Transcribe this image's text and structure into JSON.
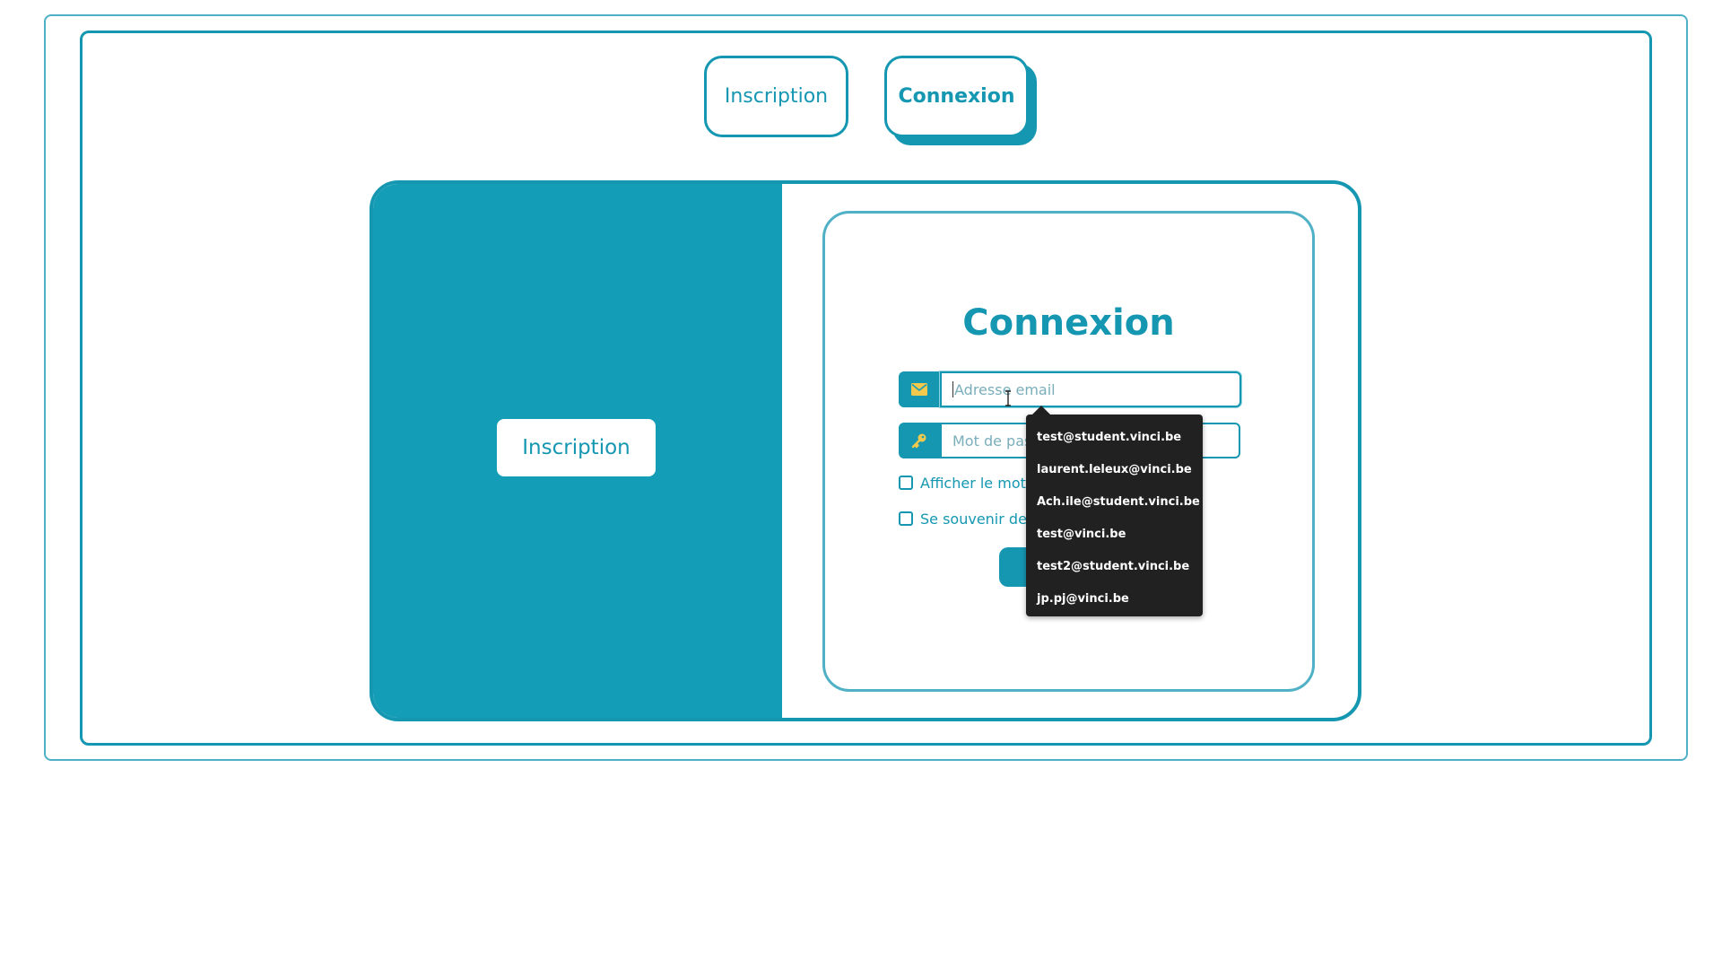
{
  "top_tabs": {
    "inscription": "Inscription",
    "connexion": "Connexion"
  },
  "left_panel": {
    "button_label": "Inscription"
  },
  "form": {
    "title": "Connexion",
    "email": {
      "placeholder": "Adresse email",
      "icon": "envelope-icon"
    },
    "password": {
      "placeholder": "Mot de pass",
      "icon": "key-icon"
    },
    "show_password_label": "Afficher le mot d",
    "remember_label": "Se souvenir de m"
  },
  "autocomplete": {
    "items": [
      "test@student.vinci.be",
      "laurent.leleux@vinci.be",
      "Ach.ile@student.vinci.be",
      "test@vinci.be",
      "test2@student.vinci.be",
      "jp.pj@vinci.be"
    ]
  },
  "colors": {
    "accent": "#1597b2",
    "icon_gold": "#f2c94c",
    "dropdown_bg": "#212122"
  }
}
